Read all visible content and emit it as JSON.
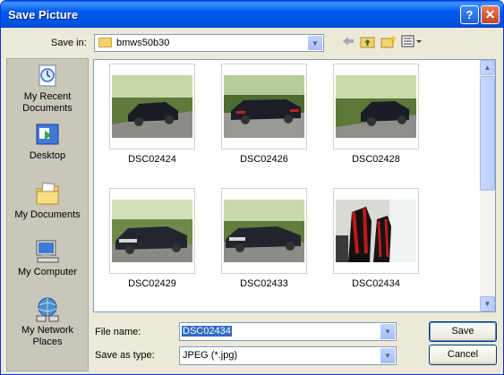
{
  "window": {
    "title": "Save Picture",
    "help_icon": "?",
    "close_icon": "✕"
  },
  "toolbar": {
    "save_in_label": "Save in:",
    "folder": "bmws50b30",
    "icons": [
      "back-icon",
      "up-folder-icon",
      "new-folder-icon",
      "views-menu-icon"
    ]
  },
  "places": [
    {
      "label": "My Recent Documents",
      "icon": "recent-documents-icon"
    },
    {
      "label": "Desktop",
      "icon": "desktop-icon"
    },
    {
      "label": "My Documents",
      "icon": "my-documents-icon"
    },
    {
      "label": "My Computer",
      "icon": "my-computer-icon"
    },
    {
      "label": "My Network Places",
      "icon": "network-places-icon"
    }
  ],
  "files": [
    {
      "name": "DSC02424"
    },
    {
      "name": "DSC02426"
    },
    {
      "name": "DSC02428"
    },
    {
      "name": "DSC02429"
    },
    {
      "name": "DSC02433"
    },
    {
      "name": "DSC02434"
    }
  ],
  "form": {
    "file_name_label": "File name:",
    "file_name_value": "DSC02434",
    "save_type_label": "Save as type:",
    "save_type_value": "JPEG (*.jpg)"
  },
  "buttons": {
    "save": "Save",
    "cancel": "Cancel"
  },
  "colors": {
    "title_bar": "#0058ee",
    "dialog_bg": "#ece9d8",
    "selection": "#316ac5"
  }
}
